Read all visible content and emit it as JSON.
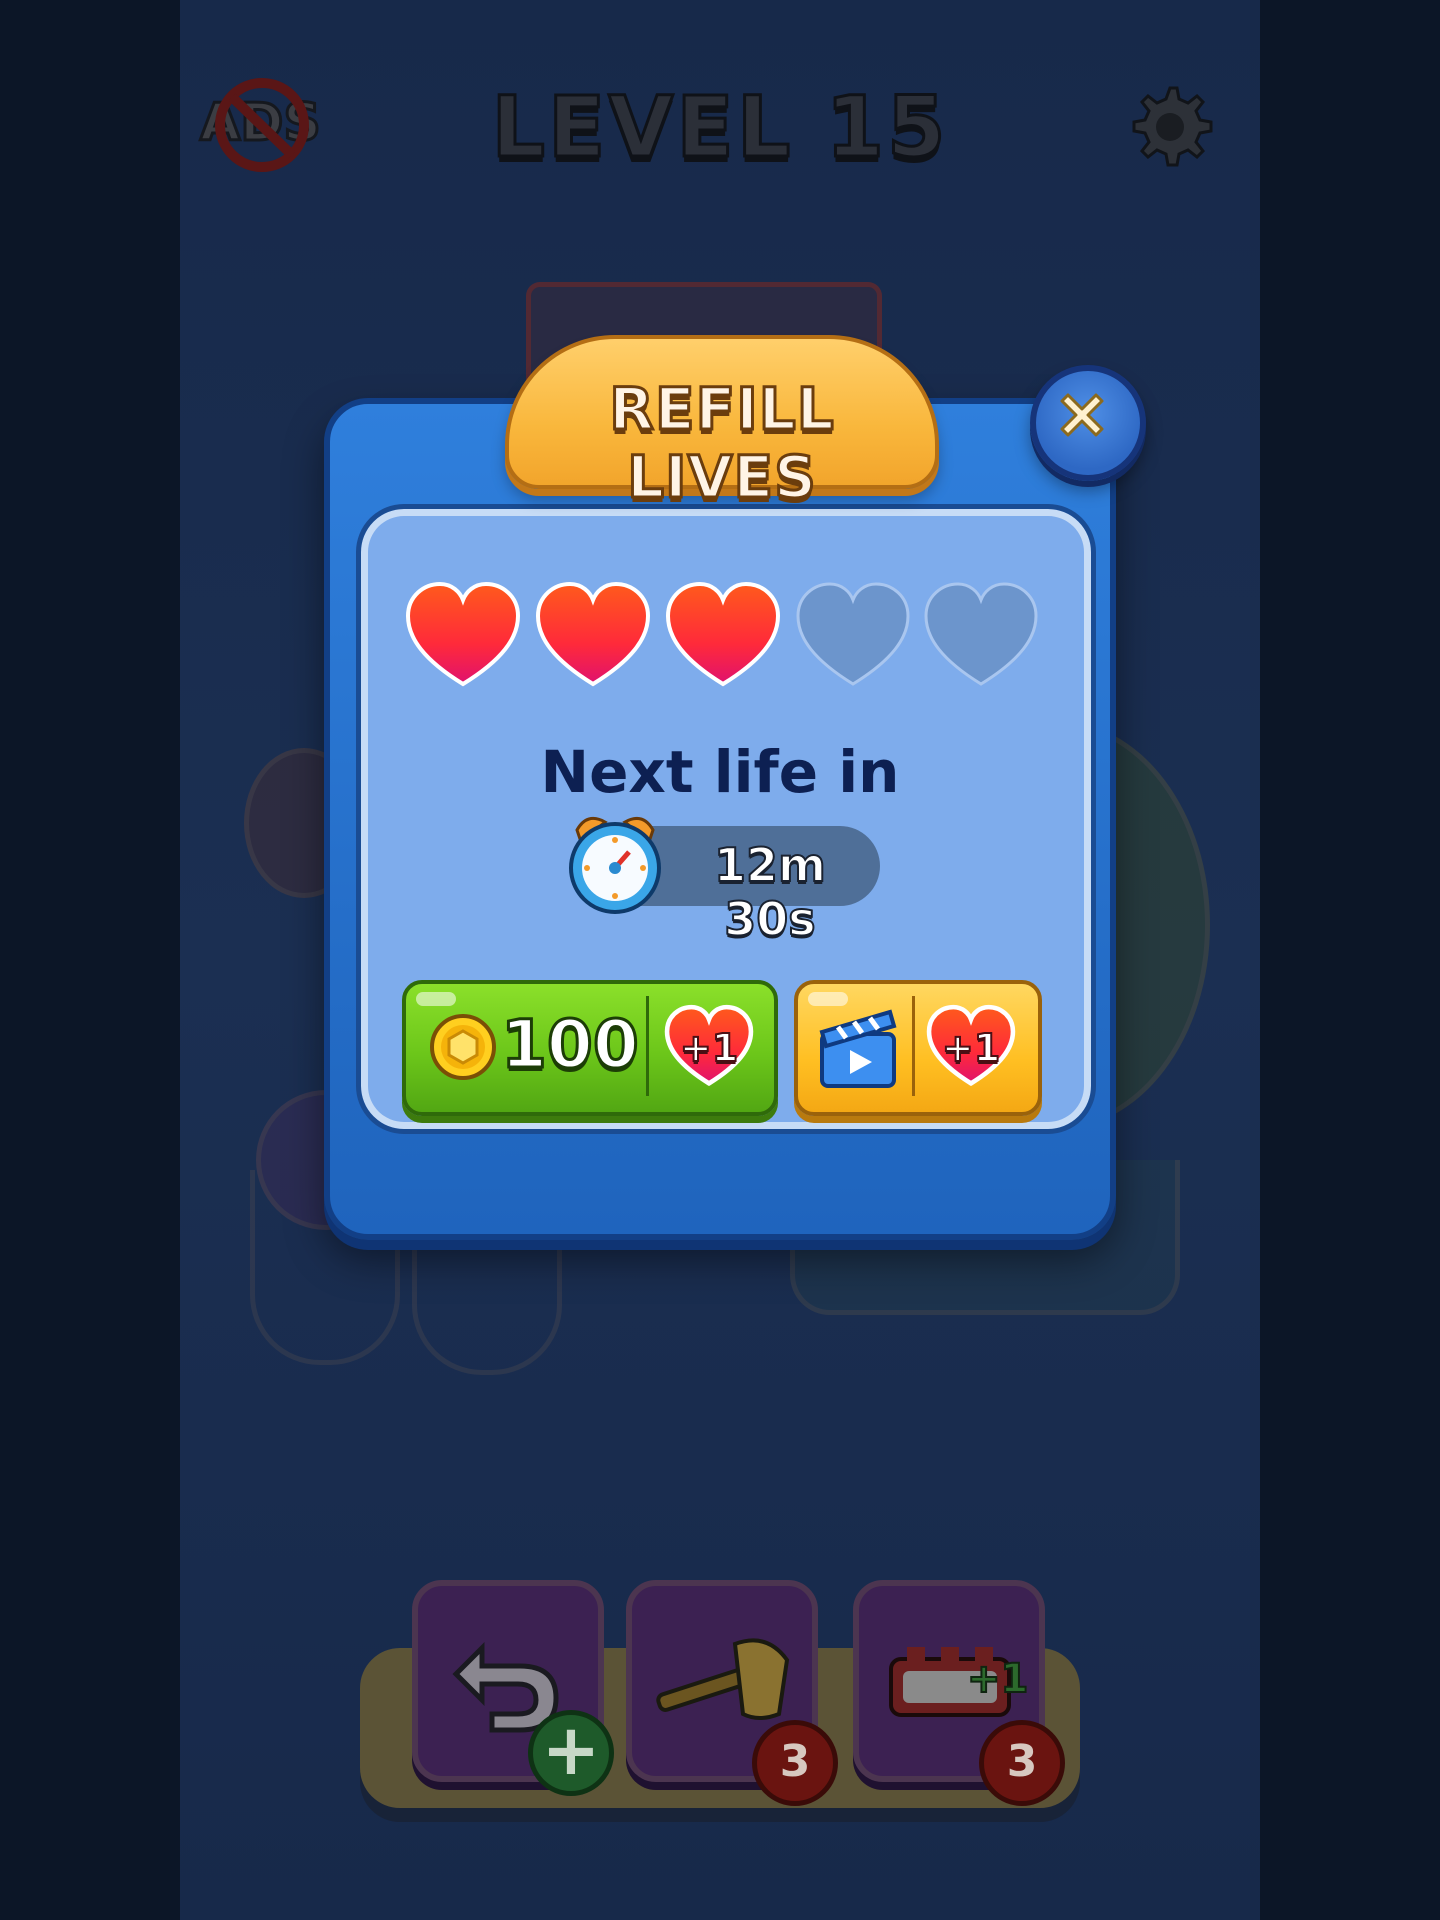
{
  "header": {
    "level_title": "LEVEL 15",
    "no_ads_label": "ADS"
  },
  "modal": {
    "title": "REFILL LIVES",
    "hearts": [
      {
        "state": "full"
      },
      {
        "state": "full"
      },
      {
        "state": "full"
      },
      {
        "state": "empty"
      },
      {
        "state": "empty"
      }
    ],
    "next_life_label": "Next life in",
    "timer": "12m 30s",
    "coin_button": {
      "price": "100",
      "reward": "+1"
    },
    "video_button": {
      "reward": "+1"
    }
  },
  "boosters": [
    {
      "name": "undo",
      "badge": "+"
    },
    {
      "name": "hammer",
      "badge": "3"
    },
    {
      "name": "extra-slot",
      "badge": "3",
      "overlay": "+1"
    }
  ],
  "colors": {
    "modal_blue": "#2f7fdc",
    "panel_blue": "#7eacec",
    "ribbon_orange": "#f9b73c",
    "coin_green": "#6cc61a",
    "video_yellow": "#ffbf22",
    "heart_red": "#ff3b28"
  }
}
